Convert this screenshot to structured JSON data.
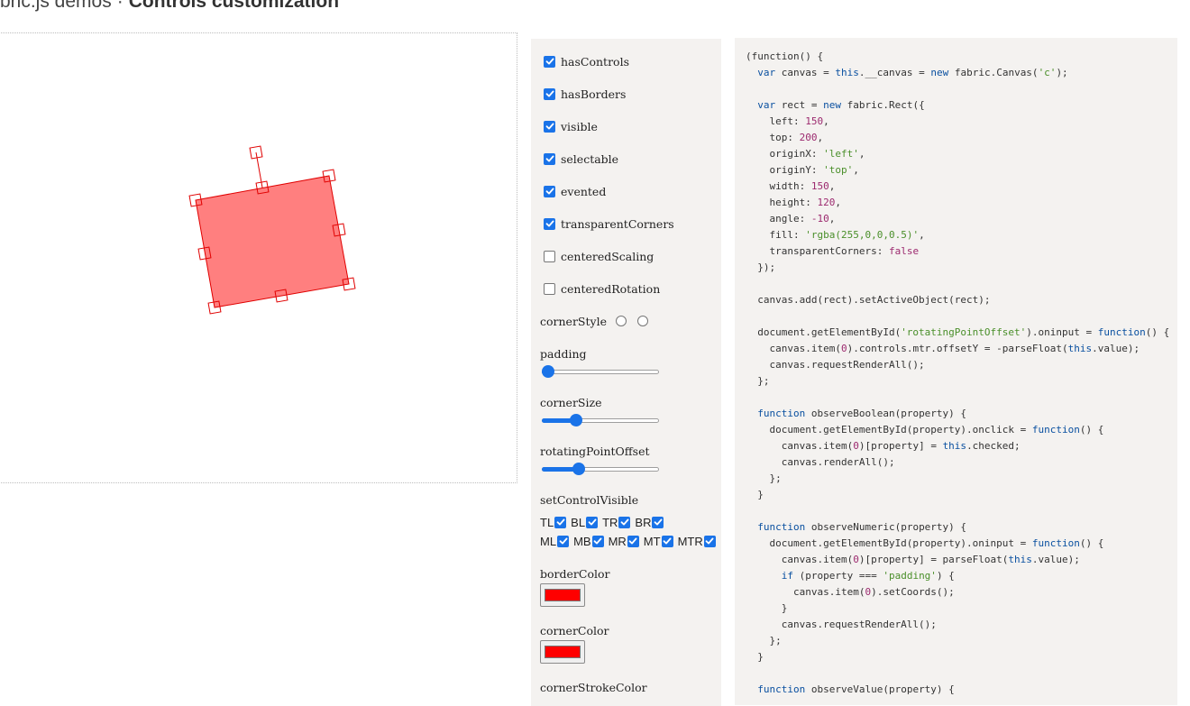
{
  "header": {
    "prefix": "bric.js demos",
    "separator": "·",
    "title": "Controls customization"
  },
  "options": {
    "hasControls": {
      "label": "hasControls",
      "checked": true
    },
    "hasBorders": {
      "label": "hasBorders",
      "checked": true
    },
    "visible": {
      "label": "visible",
      "checked": true
    },
    "selectable": {
      "label": "selectable",
      "checked": true
    },
    "evented": {
      "label": "evented",
      "checked": true
    },
    "transparentCorners": {
      "label": "transparentCorners",
      "checked": true
    },
    "centeredScaling": {
      "label": "centeredScaling",
      "checked": false
    },
    "centeredRotation": {
      "label": "centeredRotation",
      "checked": false
    }
  },
  "cornerStyle": {
    "label": "cornerStyle"
  },
  "sliders": {
    "padding": {
      "label": "padding",
      "fraction": 0.0
    },
    "cornerSize": {
      "label": "cornerSize",
      "fraction": 0.27
    },
    "rotatingPointOffset": {
      "label": "rotatingPointOffset",
      "fraction": 0.29
    }
  },
  "setControlVisible": {
    "label": "setControlVisible",
    "row1": [
      "TL",
      "BL",
      "TR",
      "BR"
    ],
    "row2": [
      "ML",
      "MB",
      "MR",
      "MT",
      "MTR"
    ]
  },
  "colors": {
    "borderColor": {
      "label": "borderColor",
      "value": "#ff0000"
    },
    "cornerColor": {
      "label": "cornerColor",
      "value": "#ff0000"
    },
    "cornerStrokeColor": {
      "label": "cornerStrokeColor"
    },
    "accent": "#1a73e8",
    "panel": "#f4f2f0",
    "rectFill": "rgba(255,0,0,0.5)"
  },
  "code": [
    [
      [
        "p",
        "(function() {"
      ]
    ],
    [
      [
        "k",
        "  var"
      ],
      [
        "p",
        " canvas = "
      ],
      [
        "k",
        "this"
      ],
      [
        "p",
        ".__canvas = "
      ],
      [
        "k",
        "new"
      ],
      [
        "p",
        " fabric.Canvas("
      ],
      [
        "s",
        "'c'"
      ],
      [
        "p",
        ");"
      ]
    ],
    [
      [
        "p",
        ""
      ]
    ],
    [
      [
        "k",
        "  var"
      ],
      [
        "p",
        " rect = "
      ],
      [
        "k",
        "new"
      ],
      [
        "p",
        " fabric.Rect({"
      ]
    ],
    [
      [
        "p",
        "    left: "
      ],
      [
        "n",
        "150"
      ],
      [
        "p",
        ","
      ]
    ],
    [
      [
        "p",
        "    top: "
      ],
      [
        "n",
        "200"
      ],
      [
        "p",
        ","
      ]
    ],
    [
      [
        "p",
        "    originX: "
      ],
      [
        "s",
        "'left'"
      ],
      [
        "p",
        ","
      ]
    ],
    [
      [
        "p",
        "    originY: "
      ],
      [
        "s",
        "'top'"
      ],
      [
        "p",
        ","
      ]
    ],
    [
      [
        "p",
        "    width: "
      ],
      [
        "n",
        "150"
      ],
      [
        "p",
        ","
      ]
    ],
    [
      [
        "p",
        "    height: "
      ],
      [
        "n",
        "120"
      ],
      [
        "p",
        ","
      ]
    ],
    [
      [
        "p",
        "    angle: "
      ],
      [
        "n",
        "-10"
      ],
      [
        "p",
        ","
      ]
    ],
    [
      [
        "p",
        "    fill: "
      ],
      [
        "s",
        "'rgba(255,0,0,0.5)'"
      ],
      [
        "p",
        ","
      ]
    ],
    [
      [
        "p",
        "    transparentCorners: "
      ],
      [
        "n",
        "false"
      ]
    ],
    [
      [
        "p",
        "  });"
      ]
    ],
    [
      [
        "p",
        ""
      ]
    ],
    [
      [
        "p",
        "  canvas.add(rect).setActiveObject(rect);"
      ]
    ],
    [
      [
        "p",
        ""
      ]
    ],
    [
      [
        "p",
        "  document.getElementById("
      ],
      [
        "s",
        "'rotatingPointOffset'"
      ],
      [
        "p",
        ").oninput = "
      ],
      [
        "k",
        "function"
      ],
      [
        "p",
        "() {"
      ]
    ],
    [
      [
        "p",
        "    canvas.item("
      ],
      [
        "n",
        "0"
      ],
      [
        "p",
        ").controls.mtr.offsetY = -parseFloat("
      ],
      [
        "k",
        "this"
      ],
      [
        "p",
        ".value);"
      ]
    ],
    [
      [
        "p",
        "    canvas.requestRenderAll();"
      ]
    ],
    [
      [
        "p",
        "  };"
      ]
    ],
    [
      [
        "p",
        ""
      ]
    ],
    [
      [
        "k",
        "  function"
      ],
      [
        "p",
        " observeBoolean(property) {"
      ]
    ],
    [
      [
        "p",
        "    document.getElementById(property).onclick = "
      ],
      [
        "k",
        "function"
      ],
      [
        "p",
        "() {"
      ]
    ],
    [
      [
        "p",
        "      canvas.item("
      ],
      [
        "n",
        "0"
      ],
      [
        "p",
        ")[property] = "
      ],
      [
        "k",
        "this"
      ],
      [
        "p",
        ".checked;"
      ]
    ],
    [
      [
        "p",
        "      canvas.renderAll();"
      ]
    ],
    [
      [
        "p",
        "    };"
      ]
    ],
    [
      [
        "p",
        "  }"
      ]
    ],
    [
      [
        "p",
        ""
      ]
    ],
    [
      [
        "k",
        "  function"
      ],
      [
        "p",
        " observeNumeric(property) {"
      ]
    ],
    [
      [
        "p",
        "    document.getElementById(property).oninput = "
      ],
      [
        "k",
        "function"
      ],
      [
        "p",
        "() {"
      ]
    ],
    [
      [
        "p",
        "      canvas.item("
      ],
      [
        "n",
        "0"
      ],
      [
        "p",
        ")[property] = parseFloat("
      ],
      [
        "k",
        "this"
      ],
      [
        "p",
        ".value);"
      ]
    ],
    [
      [
        "k",
        "      if"
      ],
      [
        "p",
        " (property === "
      ],
      [
        "s",
        "'padding'"
      ],
      [
        "p",
        ") {"
      ]
    ],
    [
      [
        "p",
        "        canvas.item("
      ],
      [
        "n",
        "0"
      ],
      [
        "p",
        ").setCoords();"
      ]
    ],
    [
      [
        "p",
        "      }"
      ]
    ],
    [
      [
        "p",
        "      canvas.requestRenderAll();"
      ]
    ],
    [
      [
        "p",
        "    };"
      ]
    ],
    [
      [
        "p",
        "  }"
      ]
    ],
    [
      [
        "p",
        ""
      ]
    ],
    [
      [
        "k",
        "  function"
      ],
      [
        "p",
        " observeValue(property) {"
      ]
    ]
  ]
}
